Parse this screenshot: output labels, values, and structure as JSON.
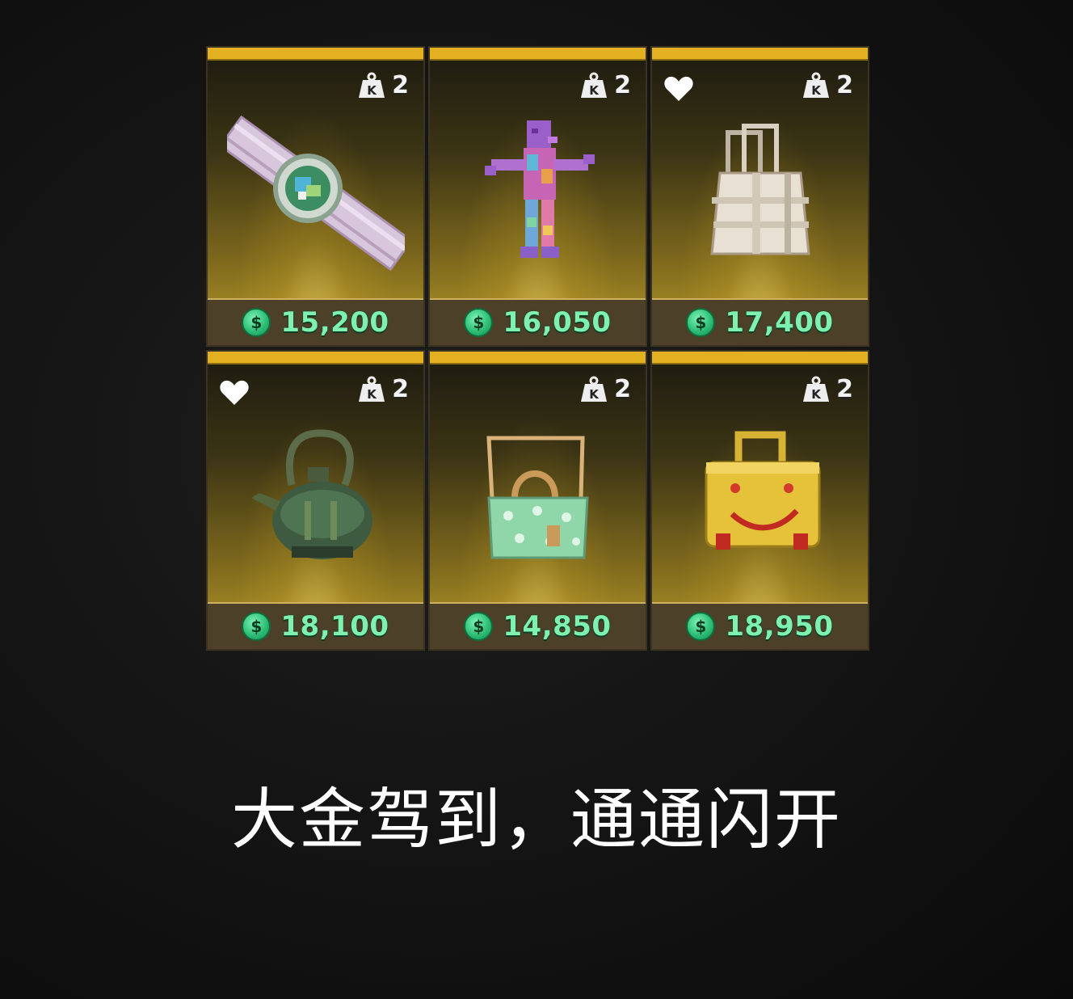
{
  "items": [
    {
      "name": "watch",
      "price": "15,200",
      "weight": "2",
      "favorited": false,
      "currency_symbol": "$"
    },
    {
      "name": "figure",
      "price": "16,050",
      "weight": "2",
      "favorited": false,
      "currency_symbol": "$"
    },
    {
      "name": "paper-bag",
      "price": "17,400",
      "weight": "2",
      "favorited": true,
      "currency_symbol": "$"
    },
    {
      "name": "teapot",
      "price": "18,100",
      "weight": "2",
      "favorited": true,
      "currency_symbol": "$"
    },
    {
      "name": "green-handbag",
      "price": "14,850",
      "weight": "2",
      "favorited": false,
      "currency_symbol": "$"
    },
    {
      "name": "yellow-case",
      "price": "18,950",
      "weight": "2",
      "favorited": false,
      "currency_symbol": "$"
    }
  ],
  "weight_icon_letter": "K",
  "caption": "大金驾到，通通闪开",
  "colors": {
    "card_top_bar": "#e3b021",
    "price_text": "#7ef0b0",
    "coin": "#2fbf77",
    "caption_text": "#ffffff"
  },
  "icons": [
    "weight-icon",
    "heart-icon",
    "coin-icon"
  ]
}
